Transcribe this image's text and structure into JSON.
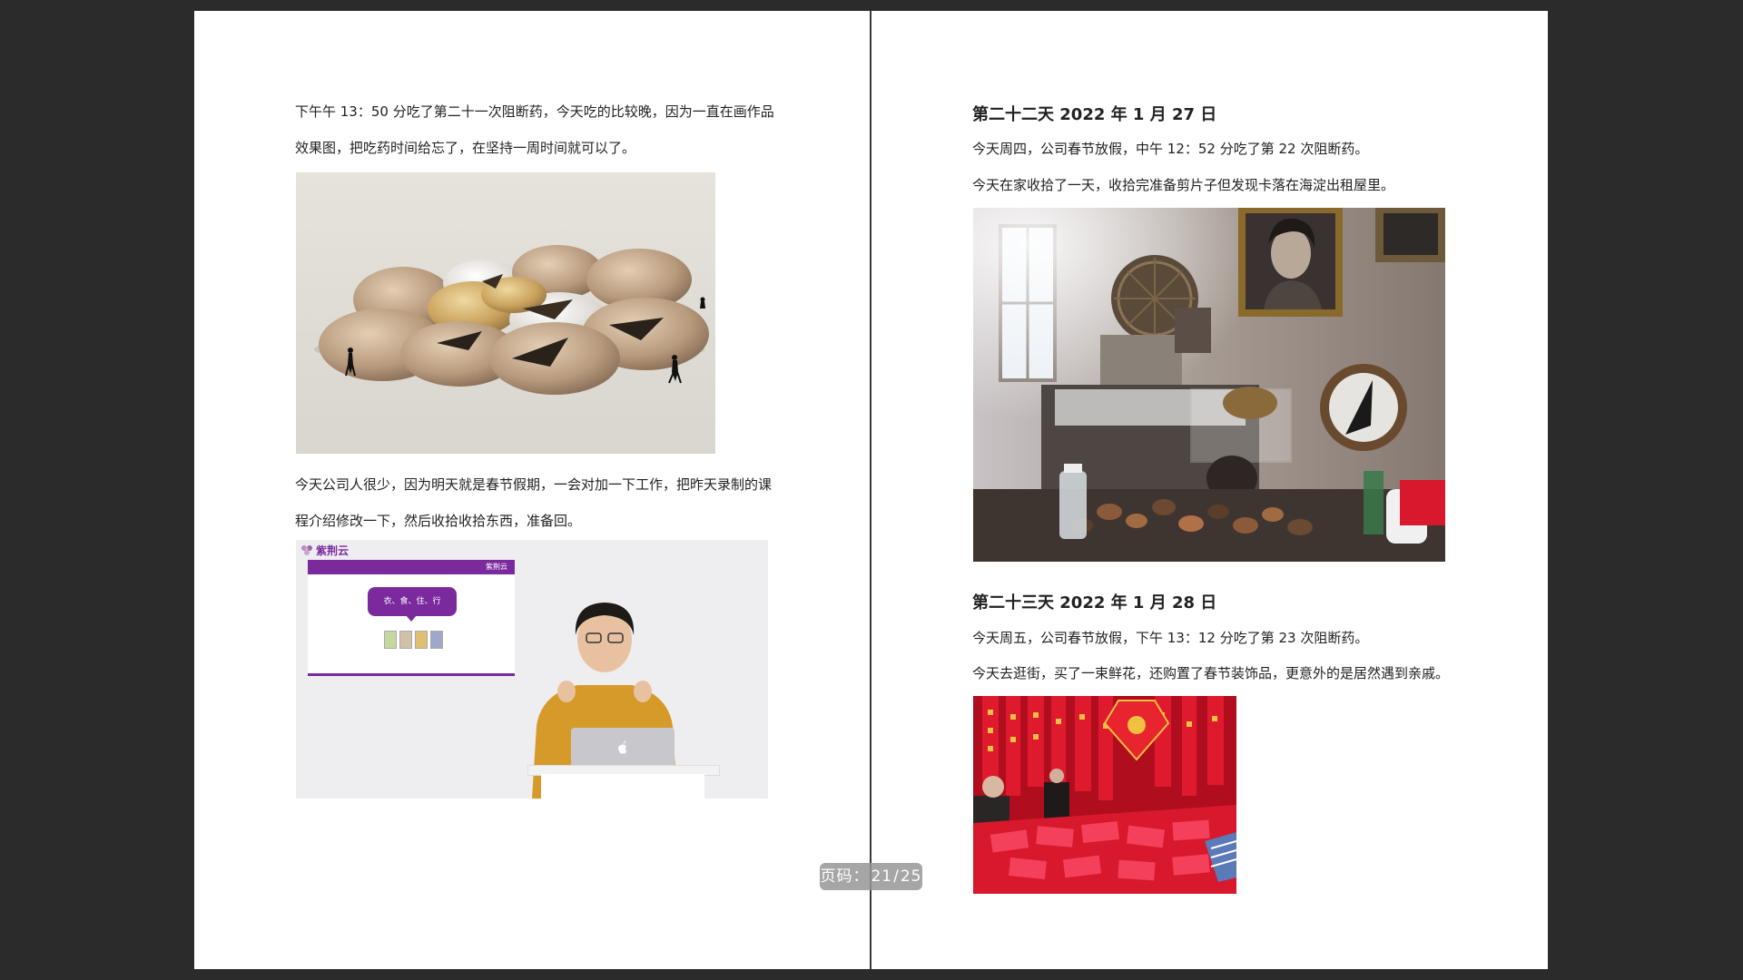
{
  "left_page": {
    "para1_line1": "下午午 13：50 分吃了第二十一次阻断药，今天吃的比较晚，因为一直在画作品",
    "para1_line2": "效果图，把吃药时间给忘了，在坚持一周时间就可以了。",
    "para2_line1": "今天公司人很少，因为明天就是春节假期，一会对加一下工作，把昨天录制的课",
    "para2_line2": "程介绍修改一下，然后收拾收拾东西，准备回。",
    "video": {
      "brand_logo": "紫荆云",
      "slide_brand": "紫荆云",
      "slide_bubble": "衣、食、住、行"
    }
  },
  "right_page": {
    "day22_heading": "第二十二天  2022 年 1 月 27 日",
    "day22_line1": "今天周四，公司春节放假，中午 12：52 分吃了第 22 次阻断药。",
    "day22_line2": "今天在家收拾了一天，收拾完准备剪片子但发现卡落在海淀出租屋里。",
    "day23_heading": "第二十三天  2022 年 1 月 28 日",
    "day23_line1": "今天周五，公司春节放假，下午 13：12 分吃了第 23 次阻断药。",
    "day23_line2": "今天去逛街，买了一束鲜花，还购置了春节装饰品，更意外的是居然遇到亲戚。"
  },
  "page_counter": {
    "label": "页码：",
    "current": "21",
    "separator": "/",
    "total": "25"
  },
  "colors": {
    "viewer_bg": "#2b2b2b",
    "page_bg": "#ffffff",
    "brand_purple": "#7b2a9e",
    "festive_red": "#d8182c"
  }
}
